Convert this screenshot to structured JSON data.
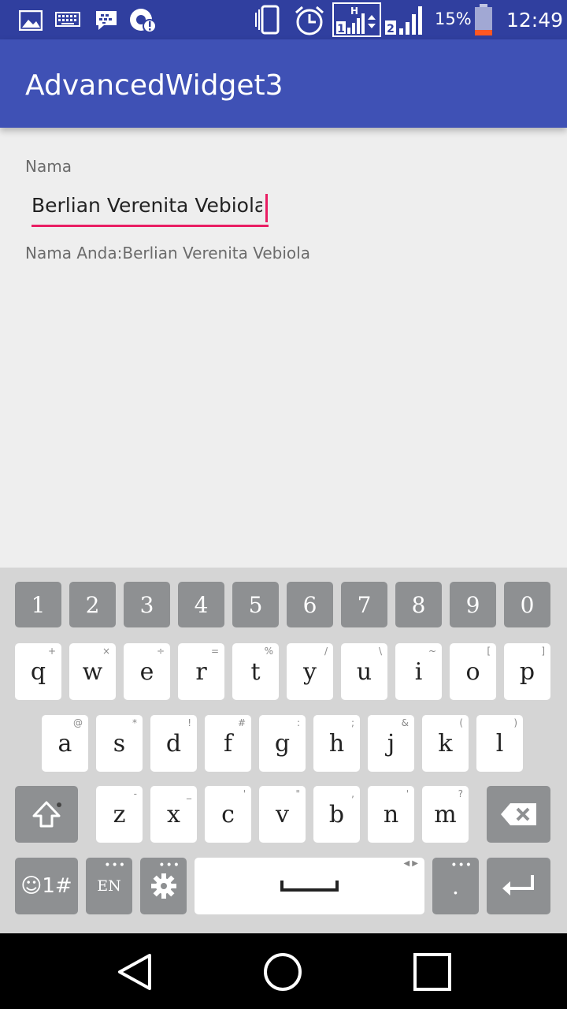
{
  "status_bar": {
    "battery_percent": "15%",
    "time": "12:49",
    "network_type": "H",
    "sim1": "1",
    "sim2": "2"
  },
  "app_bar": {
    "title": "AdvancedWidget3"
  },
  "form": {
    "label": "Nama",
    "input_value": "Berlian Verenita Vebiola",
    "result_text": "Nama Anda:Berlian Verenita Vebiola"
  },
  "keyboard": {
    "numbers": [
      "1",
      "2",
      "3",
      "4",
      "5",
      "6",
      "7",
      "8",
      "9",
      "0"
    ],
    "row1": [
      {
        "key": "q",
        "hint": "+"
      },
      {
        "key": "w",
        "hint": "×"
      },
      {
        "key": "e",
        "hint": "÷"
      },
      {
        "key": "r",
        "hint": "="
      },
      {
        "key": "t",
        "hint": "%"
      },
      {
        "key": "y",
        "hint": "/"
      },
      {
        "key": "u",
        "hint": "\\"
      },
      {
        "key": "i",
        "hint": "~"
      },
      {
        "key": "o",
        "hint": "["
      },
      {
        "key": "p",
        "hint": "]"
      }
    ],
    "row2": [
      {
        "key": "a",
        "hint": "@"
      },
      {
        "key": "s",
        "hint": "*"
      },
      {
        "key": "d",
        "hint": "!"
      },
      {
        "key": "f",
        "hint": "#"
      },
      {
        "key": "g",
        "hint": ":"
      },
      {
        "key": "h",
        "hint": ";"
      },
      {
        "key": "j",
        "hint": "&"
      },
      {
        "key": "k",
        "hint": "("
      },
      {
        "key": "l",
        "hint": ")"
      }
    ],
    "row3": [
      {
        "key": "z",
        "hint": "-"
      },
      {
        "key": "x",
        "hint": "_"
      },
      {
        "key": "c",
        "hint": "'"
      },
      {
        "key": "v",
        "hint": "\""
      },
      {
        "key": "b",
        "hint": ","
      },
      {
        "key": "n",
        "hint": "'"
      },
      {
        "key": "m",
        "hint": "?"
      }
    ],
    "symbols_label": "☺1#",
    "language_label": "EN",
    "period_label": "."
  },
  "icons": {
    "status": [
      "image-icon",
      "keyboard-icon",
      "bbm-icon",
      "sync-alert-icon",
      "vibrate-icon",
      "alarm-icon",
      "signal-icon",
      "battery-icon"
    ],
    "keyboard": [
      "shift-icon",
      "backspace-icon",
      "settings-icon",
      "space-icon",
      "enter-icon"
    ],
    "nav": [
      "back-icon",
      "home-icon",
      "recents-icon"
    ]
  },
  "colors": {
    "primary": "#3f51b5",
    "primary_dark": "#303f9f",
    "accent": "#e91e63",
    "battery_low": "#ff5722"
  }
}
